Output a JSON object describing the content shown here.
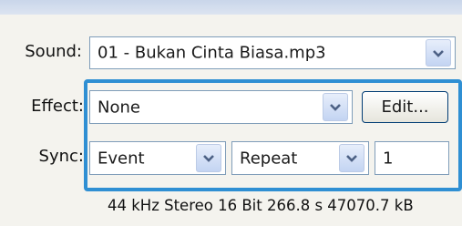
{
  "sound": {
    "label": "Sound:",
    "value": "01 - Bukan Cinta Biasa.mp3"
  },
  "effect": {
    "label": "Effect:",
    "value": "None",
    "edit_label": "Edit..."
  },
  "sync": {
    "label": "Sync:",
    "mode": "Event",
    "repeat": "Repeat",
    "count": "1"
  },
  "info": "44 kHz Stereo 16 Bit 266.8 s 47070.7 kB",
  "colors": {
    "highlight": "#2f8fd3",
    "field_border": "#7f9db9",
    "dropdown_arrow": "#4d6185"
  }
}
